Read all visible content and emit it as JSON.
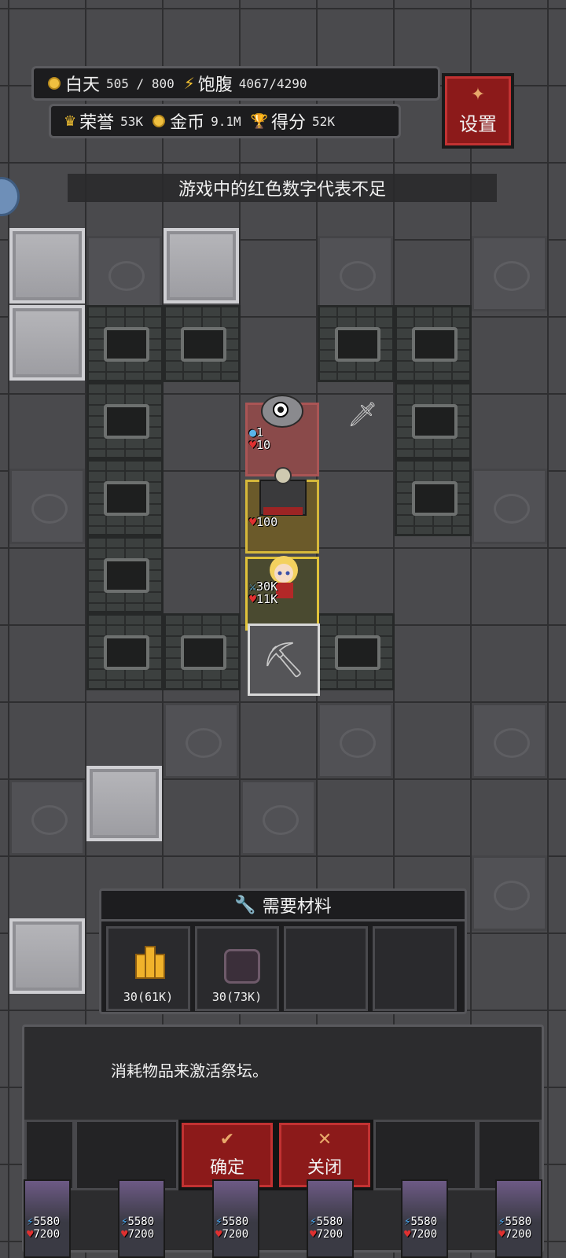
{
  "hud": {
    "day_label": "白天",
    "day_value": "505 / 800",
    "satiety_label": "饱腹",
    "satiety_value": "4067/4290",
    "honor_label": "荣誉",
    "honor_value": "53K",
    "gold_label": "金币",
    "gold_value": "9.1M",
    "score_label": "得分",
    "score_value": "52K",
    "settings_label": "设置"
  },
  "tip": "游戏中的红色数字代表不足",
  "entities": {
    "monster": {
      "potion": "1",
      "hp": "10"
    },
    "altar": {
      "hp": "100"
    },
    "hero": {
      "attack": "30K",
      "hp": "11K"
    }
  },
  "materials": {
    "header": "需要材料",
    "slots": [
      {
        "icon": "gold-bars-icon",
        "qty": "30(61K)"
      },
      {
        "icon": "ore-icon",
        "qty": "30(73K)"
      },
      {
        "icon": "",
        "qty": ""
      },
      {
        "icon": "",
        "qty": ""
      }
    ]
  },
  "dialog": {
    "message": "消耗物品来激活祭坛。",
    "confirm_label": "确定",
    "close_label": "关闭"
  },
  "bottom_units": {
    "energy": "5580",
    "hp": "7200"
  },
  "colors": {
    "button_red": "#8c1a1a",
    "gold": "#f4c232",
    "heart": "#e03030"
  }
}
